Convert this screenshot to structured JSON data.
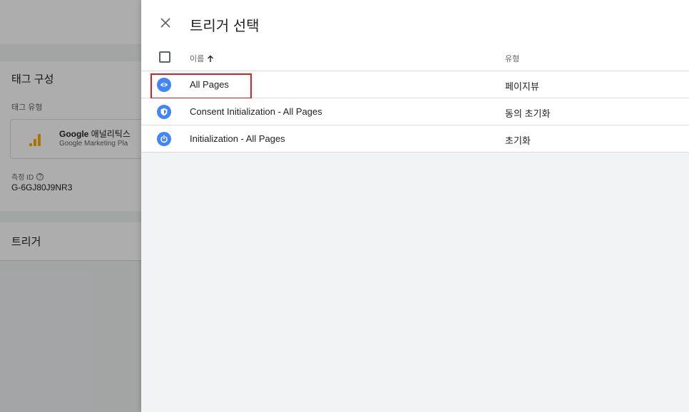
{
  "background": {
    "tag_config_title": "태그 구성",
    "tag_type_label": "태그 유형",
    "tag_type_name_bold": "Google",
    "tag_type_name_rest": " 애널리틱스",
    "tag_type_subtitle": "Google Marketing Pla",
    "measurement_id_label": "측정 ID",
    "measurement_id_value": "G-6GJ80J9NR3",
    "trigger_title": "트리거"
  },
  "dialog": {
    "title": "트리거 선택",
    "table": {
      "col_name": "이름",
      "col_type": "유형",
      "rows": [
        {
          "name": "All Pages",
          "type": "페이지뷰",
          "icon": "eye-icon"
        },
        {
          "name": "Consent Initialization - All Pages",
          "type": "동의 초기화",
          "icon": "shield-icon"
        },
        {
          "name": "Initialization - All Pages",
          "type": "초기화",
          "icon": "power-icon"
        }
      ]
    }
  },
  "colors": {
    "accent_blue": "#4285f4",
    "analytics_orange": "#f9ab00",
    "highlight_red": "#e01f1f"
  }
}
